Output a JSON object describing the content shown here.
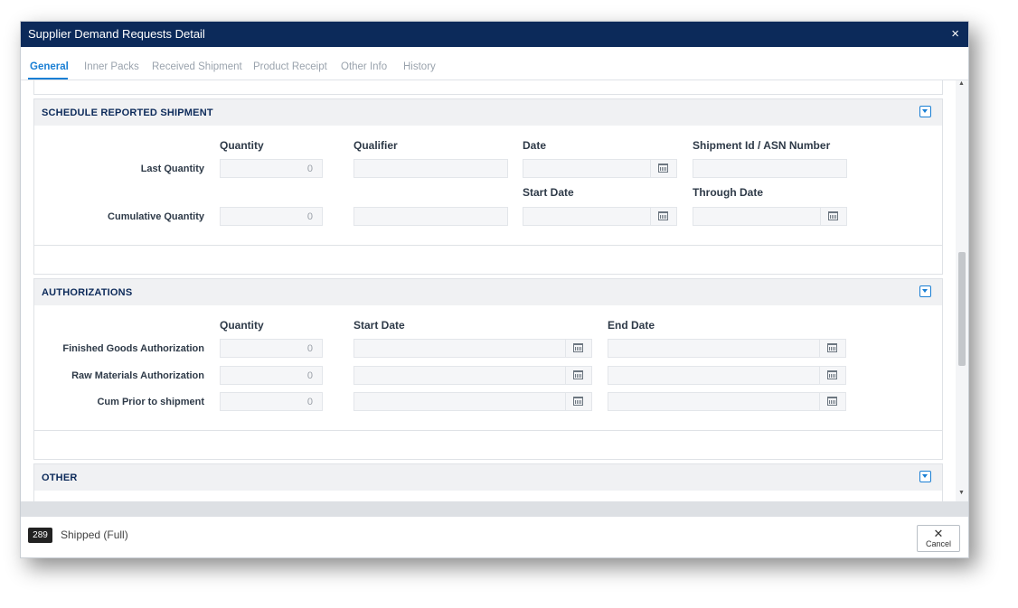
{
  "window": {
    "title": "Supplier Demand Requests Detail",
    "close_icon": "×"
  },
  "tabs": [
    {
      "label": "General",
      "active": true
    },
    {
      "label": "Inner Packs"
    },
    {
      "label": "Received Shipment"
    },
    {
      "label": "Product Receipt"
    },
    {
      "label": "Other Info"
    },
    {
      "label": "History"
    }
  ],
  "schedule": {
    "title": "SCHEDULE REPORTED SHIPMENT",
    "headers": {
      "quantity": "Quantity",
      "qualifier": "Qualifier",
      "date": "Date",
      "shipment_id": "Shipment Id / ASN Number",
      "start_date": "Start Date",
      "through_date": "Through Date"
    },
    "rows": [
      {
        "label": "Last Quantity",
        "quantity": "0"
      },
      {
        "label": "Cumulative Quantity",
        "quantity": "0"
      }
    ]
  },
  "authorizations": {
    "title": "AUTHORIZATIONS",
    "headers": {
      "quantity": "Quantity",
      "start_date": "Start Date",
      "end_date": "End Date"
    },
    "rows": [
      {
        "label": "Finished Goods Authorization",
        "quantity": "0"
      },
      {
        "label": "Raw Materials Authorization",
        "quantity": "0"
      },
      {
        "label": "Cum Prior to shipment",
        "quantity": "0"
      }
    ]
  },
  "other": {
    "title": "OTHER"
  },
  "footer": {
    "badge": "289",
    "status": "Shipped (Full)",
    "cancel_label": "Cancel",
    "cancel_icon": "✕"
  },
  "colors": {
    "titlebar": "#0c2a5a",
    "accent": "#1a7fd4"
  }
}
